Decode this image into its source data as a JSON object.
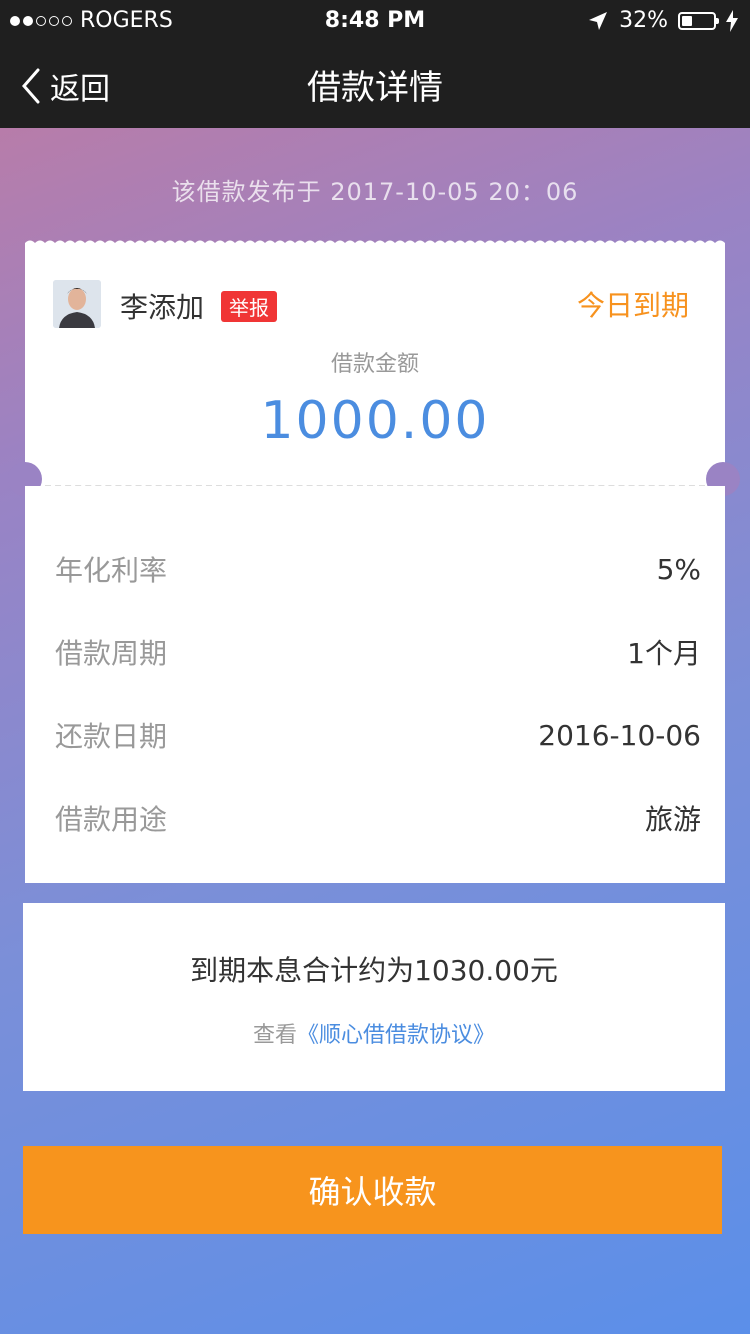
{
  "status_bar": {
    "carrier": "ROGERS",
    "time": "8:48 PM",
    "battery": "32%"
  },
  "nav": {
    "back_label": "返回",
    "title": "借款详情"
  },
  "publish_info": "该借款发布于 2017-10-05  20：06",
  "borrower": {
    "name": "李添加",
    "report_label": "举报",
    "due_status": "今日到期"
  },
  "amount": {
    "label": "借款金额",
    "value": "1000.00"
  },
  "details": [
    {
      "label": "年化利率",
      "value": "5%"
    },
    {
      "label": "借款周期",
      "value": "1个月"
    },
    {
      "label": "还款日期",
      "value": "2016-10-06"
    },
    {
      "label": "借款用途",
      "value": "旅游"
    }
  ],
  "summary": {
    "total_text": "到期本息合计约为1030.00元",
    "agreement_prefix": "查看",
    "agreement_link": "《顺心借借款协议》"
  },
  "confirm_button": "确认收款",
  "colors": {
    "accent_orange": "#f7941d",
    "amount_blue": "#4b8de0",
    "report_red": "#f03535"
  }
}
